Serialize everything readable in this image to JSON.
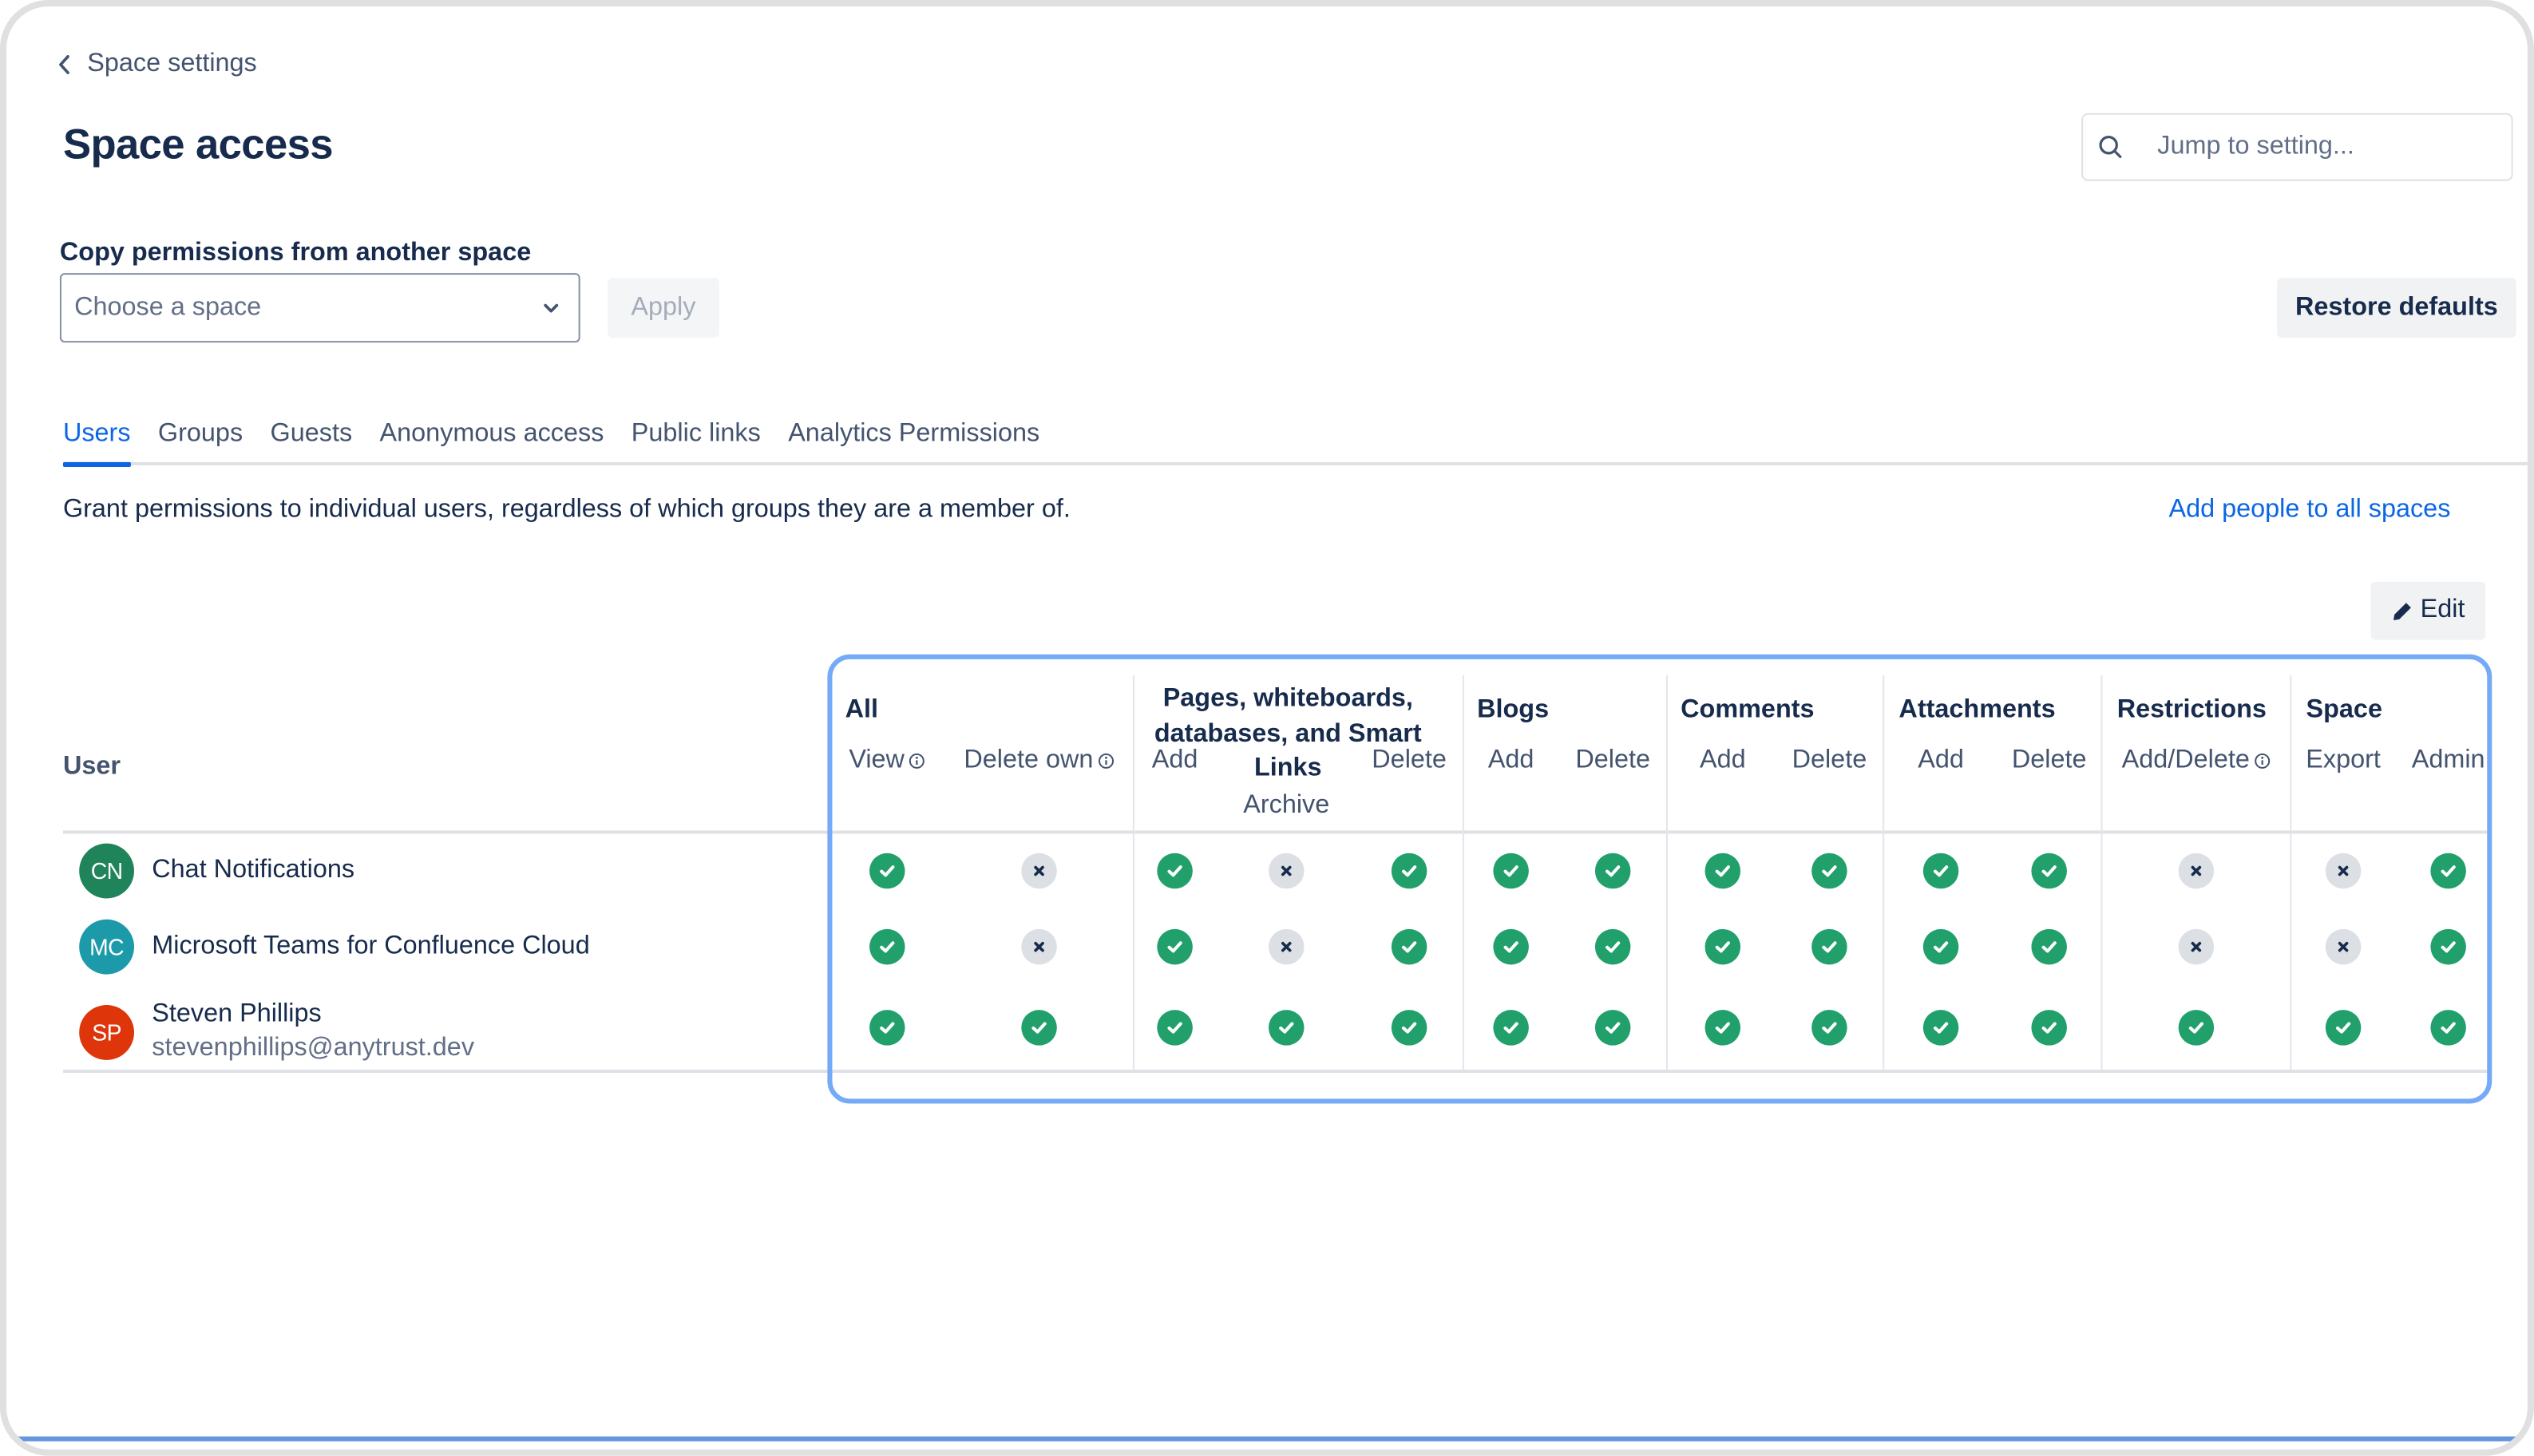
{
  "header": {
    "breadcrumb": "Space settings",
    "title": "Space access",
    "search_placeholder": "Jump to setting..."
  },
  "copy_permissions": {
    "label": "Copy permissions from another space",
    "select_placeholder": "Choose a space",
    "apply_label": "Apply"
  },
  "restore_defaults_label": "Restore defaults",
  "tabs": [
    {
      "label": "Users",
      "active": true
    },
    {
      "label": "Groups",
      "active": false
    },
    {
      "label": "Guests",
      "active": false
    },
    {
      "label": "Anonymous access",
      "active": false
    },
    {
      "label": "Public links",
      "active": false
    },
    {
      "label": "Analytics Permissions",
      "active": false
    }
  ],
  "description": "Grant permissions to individual users, regardless of which groups they are a member of.",
  "add_people_link": "Add people to all spaces",
  "edit_label": "Edit",
  "table": {
    "user_header": "User",
    "groups": [
      {
        "label": "All",
        "columns": [
          {
            "label": "View",
            "info": true
          },
          {
            "label": "Delete own",
            "info": true
          }
        ]
      },
      {
        "label": "Pages, whiteboards, databases, and Smart Links",
        "columns": [
          {
            "label": "Add",
            "info": false
          },
          {
            "label": "Archive",
            "info": false
          },
          {
            "label": "Delete",
            "info": false
          }
        ]
      },
      {
        "label": "Blogs",
        "columns": [
          {
            "label": "Add",
            "info": false
          },
          {
            "label": "Delete",
            "info": false
          }
        ]
      },
      {
        "label": "Comments",
        "columns": [
          {
            "label": "Add",
            "info": false
          },
          {
            "label": "Delete",
            "info": false
          }
        ]
      },
      {
        "label": "Attachments",
        "columns": [
          {
            "label": "Add",
            "info": false
          },
          {
            "label": "Delete",
            "info": false
          }
        ]
      },
      {
        "label": "Restrictions",
        "columns": [
          {
            "label": "Add/Delete",
            "info": true
          }
        ]
      },
      {
        "label": "Space",
        "columns": [
          {
            "label": "Export",
            "info": false
          },
          {
            "label": "Admin",
            "info": false
          }
        ]
      }
    ],
    "rows": [
      {
        "initials": "CN",
        "avatar_color": "#1f845a",
        "name": "Chat Notifications",
        "email": "",
        "permissions": [
          true,
          false,
          true,
          false,
          true,
          true,
          true,
          true,
          true,
          true,
          true,
          false,
          false,
          true
        ]
      },
      {
        "initials": "MC",
        "avatar_color": "#1d9aaa",
        "name": "Microsoft Teams for Confluence Cloud",
        "email": "",
        "permissions": [
          true,
          false,
          true,
          false,
          true,
          true,
          true,
          true,
          true,
          true,
          true,
          false,
          false,
          true
        ]
      },
      {
        "initials": "SP",
        "avatar_color": "#de350b",
        "name": "Steven Phillips",
        "email": "stevenphillips@anytrust.dev",
        "permissions": [
          true,
          true,
          true,
          true,
          true,
          true,
          true,
          true,
          true,
          true,
          true,
          true,
          true,
          true
        ]
      }
    ]
  },
  "colors": {
    "accent": "#0c66e4",
    "granted": "#22a06b",
    "denied": "#dcdfe4",
    "highlight": "#75aaf7"
  }
}
